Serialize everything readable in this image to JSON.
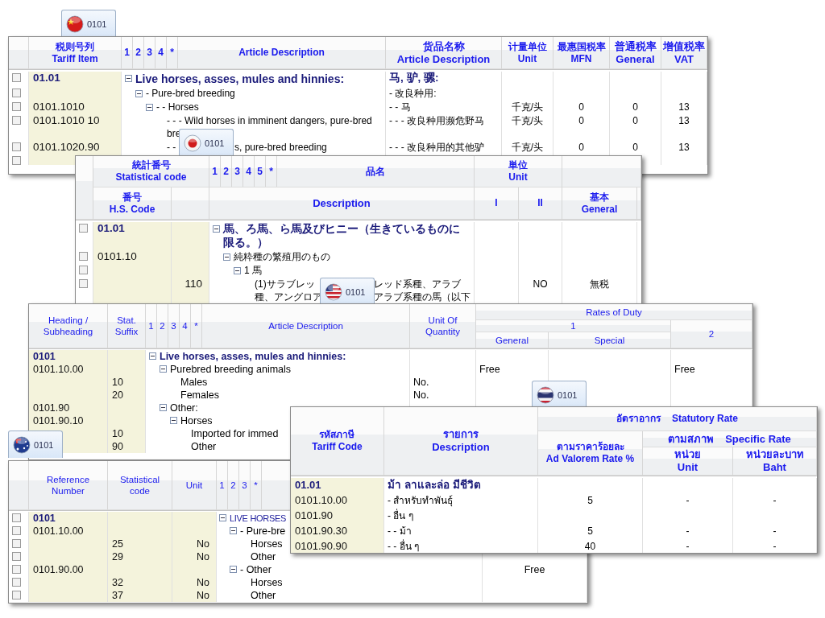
{
  "china": {
    "tab": {
      "label": "0101"
    },
    "header": {
      "code": "税则号列\nTariff Item",
      "levels": [
        "1",
        "2",
        "3",
        "4",
        "*"
      ],
      "description": "Article Description",
      "name_cn": "货品名称\nArticle Description",
      "unit": "计量单位\nUnit",
      "mfn": "最惠国税率\nMFN",
      "general": "普通税率\nGeneral",
      "vat": "增值税率\nVAT"
    },
    "rows": [
      {
        "checked": false,
        "code": "01.01",
        "heading": true,
        "expanded": true,
        "text": "Live horses, asses, mules and hinnies:",
        "cn": "马, 驴, 骡:",
        "children": [
          {
            "checked": false,
            "expanded": true,
            "text": "- Pure-bred breeding",
            "cn": "- 改良种用:",
            "children": [
              {
                "checked": false,
                "code": "0101.1010",
                "expanded": true,
                "text": "- - Horses",
                "cn": "- - 马",
                "unit": "千克/头",
                "mfn": "0",
                "general": "0",
                "vat": "13",
                "children": [
                  {
                    "checked": false,
                    "code": "0101.1010 10",
                    "text": "- - - Wild horses in imminent dangers, pure-bred\nbre",
                    "cn": "- - - 改良种用濒危野马",
                    "unit": "千克/头",
                    "mfn": "0",
                    "general": "0",
                    "vat": "13"
                  },
                  {
                    "checked": false,
                    "code": "0101.1020.90",
                    "parts": [
                      "- -",
                      "s, pure-bred breeding"
                    ],
                    "cn": "- - - 改良种用的其他驴",
                    "unit": "千克/头",
                    "mfn": "0",
                    "general": "0",
                    "vat": "13"
                  }
                ]
              }
            ]
          }
        ]
      },
      {
        "checked": false
      }
    ]
  },
  "japan": {
    "tab": {
      "label": "0101"
    },
    "header": {
      "stat_code": "統計番号\nStatistical code",
      "levels": [
        "1",
        "2",
        "3",
        "4",
        "5",
        "*"
      ],
      "name": "品名",
      "unit": "単位\nUnit",
      "hs_code": "番号\nH.S. Code",
      "description": "Description",
      "rate_1": "I",
      "rate_2": "II",
      "general": "基本\nGeneral"
    },
    "rows": [
      {
        "checked": false,
        "code": "01.01",
        "heading": true,
        "expanded": true,
        "text": "馬、ろ馬、ら馬及びヒニー（生きているものに限る。）",
        "children": [
          {
            "checked": false,
            "code": "0101.10",
            "expanded": true,
            "text": "純粋種の繁殖用のもの",
            "children": [
              {
                "checked": false,
                "expanded": true,
                "text": "1 馬",
                "children": [
                  {
                    "checked": false,
                    "suffix": "110",
                    "lines": [
                      {
                        "left": "(1)サラブレッ",
                        "right": "レッド系種、アラブ"
                      },
                      {
                        "left": "種、アングロア",
                        "right": "アラブ系種の馬（以下"
                      }
                    ],
                    "rate_2": "NO",
                    "general": "無税"
                  }
                ]
              }
            ]
          }
        ]
      }
    ]
  },
  "us": {
    "tab": {
      "label": "0101"
    },
    "header": {
      "heading": "Heading /\nSubheading",
      "suffix": "Stat.\nSuffix",
      "levels": [
        "1",
        "2",
        "3",
        "4",
        "*"
      ],
      "description": "Article Description",
      "unit": "Unit Of\nQuantity",
      "rates": "Rates of Duty",
      "col_1": "1",
      "general": "General",
      "special": "Special",
      "col_2": "2"
    },
    "rows": [
      {
        "code": "0101",
        "heading": true,
        "expanded": true,
        "text": "Live horses, asses, mules and hinnies:",
        "children": [
          {
            "code": "0101.10.00",
            "expanded": true,
            "text": "Purebred breeding animals",
            "general": "Free",
            "col_2": "Free",
            "children": [
              {
                "suffix": "10",
                "text": "Males",
                "unit": "No."
              },
              {
                "suffix": "20",
                "text": "Females",
                "unit": "No."
              }
            ]
          },
          {
            "code": "0101.90",
            "expanded": true,
            "text": "Other:",
            "children": [
              {
                "code": "0101.90.10",
                "expanded": true,
                "text": "Horses",
                "children": [
                  {
                    "suffix": "10",
                    "text": "Imported for immed"
                  },
                  {
                    "suffix": "90",
                    "text": "Other"
                  }
                ]
              }
            ]
          }
        ]
      }
    ]
  },
  "thailand": {
    "tab": {
      "label": "0101"
    },
    "header": {
      "code": "รหัสภาษี\nTariff Code",
      "description": "รายการ\nDescription",
      "statutory_th": "อัตราอากร",
      "statutory_en": "Statutory Rate",
      "ad_valorem": "ตามราคาร้อยละ\nAd Valorem Rate %",
      "specific_th": "ตามสภาพ",
      "specific_en": "Specific Rate",
      "unit": "หน่วย\nUnit",
      "baht": "หน่วยละบาท\nBaht"
    },
    "rows": [
      {
        "code": "01.01",
        "heading": true,
        "text": "ม้า ลาและล่อ มีชีวิต"
      },
      {
        "code": "0101.10.00",
        "text": "- สำหรับทำพันธุ์",
        "ad_valorem": "5",
        "unit": "-",
        "baht": "-"
      },
      {
        "code": "0101.90",
        "text": "- อื่น ๆ"
      },
      {
        "code": "0101.90.30",
        "text": "- - ม้า",
        "ad_valorem": "5",
        "unit": "-",
        "baht": "-"
      },
      {
        "code": "0101.90.90",
        "text": "- - อื่น ๆ",
        "ad_valorem": "40",
        "unit": "-",
        "baht": "-"
      }
    ]
  },
  "australia": {
    "tab": {
      "label": "0101"
    },
    "header": {
      "reference": "Reference\nNumber",
      "statistical": "Statistical\ncode",
      "unit": "Unit",
      "levels": [
        "1",
        "2",
        "3",
        "*"
      ]
    },
    "rows": [
      {
        "checked": false,
        "code": "0101",
        "heading": true,
        "expanded": true,
        "text": "LIVE HORSES",
        "children": [
          {
            "checked": false,
            "code": "0101.10.00",
            "expanded": true,
            "text": "- Pure-bre",
            "children": [
              {
                "checked": false,
                "stat": "25",
                "unit": "No",
                "text": "Horses"
              },
              {
                "checked": false,
                "stat": "29",
                "unit": "No",
                "text": "Other"
              }
            ]
          },
          {
            "checked": false,
            "code": "0101.90.00",
            "expanded": true,
            "text": "- Other",
            "rate": "Free",
            "children": [
              {
                "checked": false,
                "stat": "32",
                "unit": "No",
                "text": "Horses"
              },
              {
                "checked": false,
                "stat": "37",
                "unit": "No",
                "text": "Other"
              }
            ]
          }
        ]
      }
    ]
  }
}
